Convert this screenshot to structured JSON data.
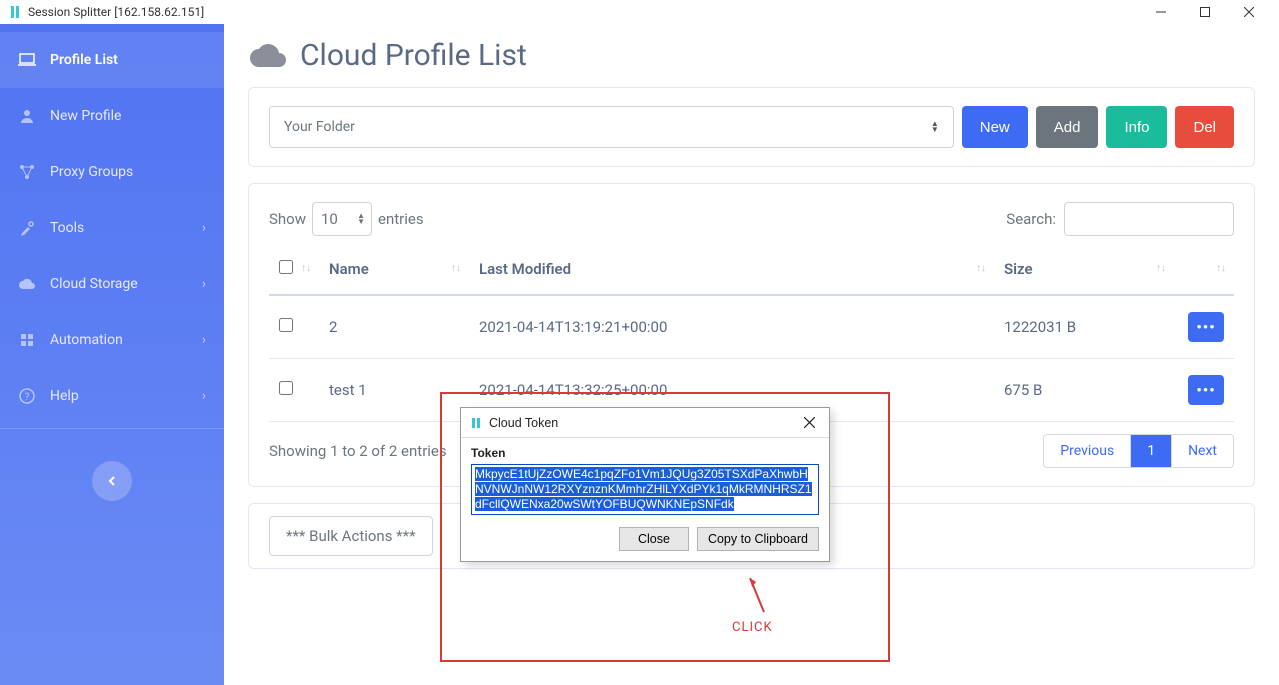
{
  "window": {
    "title": "Session Splitter [162.158.62.151]"
  },
  "sidebar": {
    "items": [
      {
        "label": "Profile List"
      },
      {
        "label": "New Profile"
      },
      {
        "label": "Proxy Groups"
      },
      {
        "label": "Tools"
      },
      {
        "label": "Cloud Storage"
      },
      {
        "label": "Automation"
      },
      {
        "label": "Help"
      }
    ]
  },
  "page": {
    "title": "Cloud Profile List"
  },
  "topbar": {
    "folder_label": "Your Folder",
    "new_label": "New",
    "add_label": "Add",
    "info_label": "Info",
    "del_label": "Del"
  },
  "datatable": {
    "show_label": "Show",
    "entries_label": "entries",
    "entries_value": "10",
    "search_label": "Search:",
    "columns": {
      "name": "Name",
      "modified": "Last Modified",
      "size": "Size"
    },
    "rows": [
      {
        "name": "2",
        "modified": "2021-04-14T13:19:21+00:00",
        "size": "1222031 B"
      },
      {
        "name": "test 1",
        "modified": "2021-04-14T13:32:25+00:00",
        "size": "675 B"
      }
    ],
    "info": "Showing 1 to 2 of 2 entries",
    "pager": {
      "prev": "Previous",
      "page": "1",
      "next": "Next"
    }
  },
  "bulk": {
    "label": "*** Bulk Actions ***"
  },
  "dialog": {
    "title": "Cloud Token",
    "token_label": "Token",
    "token_value": "MkpycE1tUjZzOWE4c1pqZFo1Vm1JQUg3Z05TSXdPaXhwbHNVNWJnNW12RXYznznKMmhrZHlLYXdPYk1qMkRMNHRSZ1dFcllQWENxa20wSWtYOFBUQWNKNEpSNFdk",
    "close_label": "Close",
    "copy_label": "Copy to Clipboard"
  },
  "annotation": {
    "click": "CLICK"
  }
}
